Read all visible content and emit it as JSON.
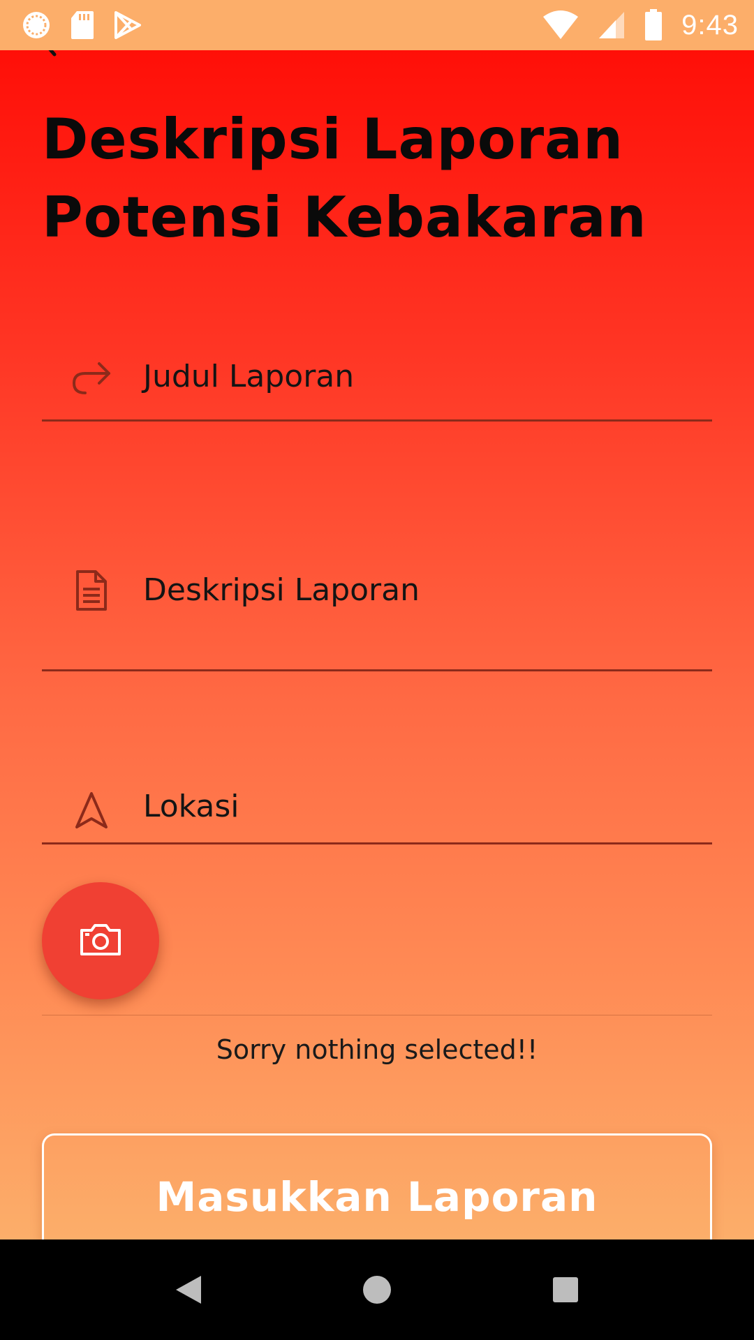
{
  "status_bar": {
    "time": "9:43",
    "left_icons": [
      "sync-icon",
      "sd-card-icon",
      "play-store-icon"
    ],
    "right_icons": [
      "wifi-icon",
      "signal-icon",
      "battery-icon"
    ]
  },
  "header": {
    "back_icon": "chevron-left-icon",
    "title": "Deskripsi Laporan Potensi Kebakaran"
  },
  "form": {
    "title_field": {
      "placeholder": "Judul Laporan",
      "icon": "forward-arrow-icon"
    },
    "description_field": {
      "placeholder": "Deskripsi Laporan",
      "icon": "document-icon"
    },
    "location_field": {
      "placeholder": "Lokasi",
      "icon": "navigation-icon"
    }
  },
  "camera": {
    "icon": "camera-icon"
  },
  "image_status": "Sorry nothing selected!!",
  "submit_label": "Masukkan Laporan",
  "nav_bar": {
    "icons": [
      "back-triangle-icon",
      "home-circle-icon",
      "recents-square-icon"
    ]
  },
  "colors": {
    "status_bar": "#FCAE6A",
    "gradient_top": "#FF0F08",
    "gradient_bottom": "#FCAE6A",
    "fab": "#F04033",
    "field_line": "#8C2A1A"
  }
}
